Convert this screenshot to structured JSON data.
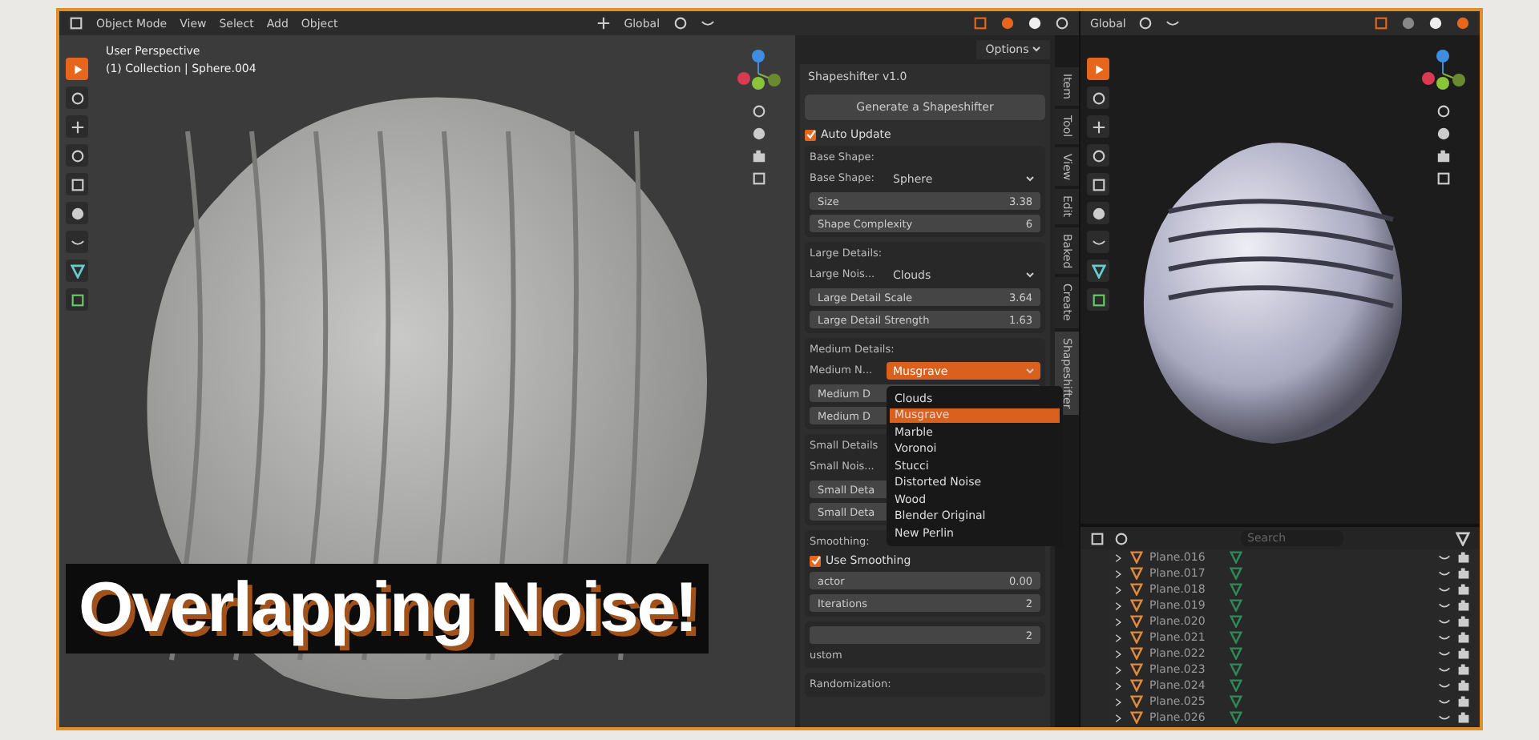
{
  "header_left": {
    "menu": [
      "Object Mode",
      "View",
      "Select",
      "Add",
      "Object"
    ],
    "orientation": "Global"
  },
  "viewport_left": {
    "info": [
      "User Perspective",
      "(1) Collection | Sphere.004"
    ]
  },
  "header_right": {
    "orientation": "Global"
  },
  "options_button": "Options",
  "panel": {
    "title": "Shapeshifter v1.0",
    "generate_button": "Generate a Shapeshifter",
    "auto_update": {
      "label": "Auto Update",
      "checked": true
    },
    "sections": [
      {
        "title": "Base Shape:",
        "rows": [
          {
            "kind": "select",
            "label": "Base Shape:",
            "value": "Sphere",
            "open": false
          },
          {
            "kind": "field",
            "label": "Size",
            "value": "3.38"
          },
          {
            "kind": "field",
            "label": "Shape Complexity",
            "value": "6"
          }
        ]
      },
      {
        "title": "Large Details:",
        "rows": [
          {
            "kind": "select",
            "label": "Large Nois...",
            "value": "Clouds",
            "open": false
          },
          {
            "kind": "field",
            "label": "Large Detail Scale",
            "value": "3.64"
          },
          {
            "kind": "field",
            "label": "Large Detail Strength",
            "value": "1.63"
          }
        ]
      },
      {
        "title": "Medium Details:",
        "rows": [
          {
            "kind": "select",
            "label": "Medium N...",
            "value": "Musgrave",
            "open": true
          },
          {
            "kind": "field",
            "label": "Medium D"
          },
          {
            "kind": "field",
            "label": "Medium D"
          }
        ]
      },
      {
        "title": "Small Details",
        "rows": [
          {
            "kind": "select",
            "label": "Small Nois..."
          },
          {
            "kind": "field",
            "label": "Small Deta"
          },
          {
            "kind": "field",
            "label": "Small Deta"
          }
        ]
      },
      {
        "title": "Smoothing:",
        "rows": [
          {
            "kind": "checkbox",
            "label": "Use Smoothing",
            "checked": true
          },
          {
            "kind": "field",
            "label": "actor",
            "value": "0.00"
          },
          {
            "kind": "field",
            "label": "Iterations",
            "value": "2"
          }
        ]
      },
      {
        "rows": [
          {
            "kind": "field",
            "value": "2"
          },
          {
            "kind": "text",
            "label": "ustom"
          }
        ]
      },
      {
        "title": "Randomization:"
      }
    ]
  },
  "dropdown": {
    "items": [
      {
        "label": "Clouds",
        "selected": false
      },
      {
        "label": "Musgrave",
        "selected": true
      },
      {
        "label": "Marble",
        "selected": false
      },
      {
        "label": "Voronoi",
        "selected": false
      },
      {
        "label": "Stucci",
        "selected": false
      },
      {
        "label": "Distorted Noise",
        "selected": false
      },
      {
        "label": "Wood",
        "selected": false
      },
      {
        "label": "Blender Original",
        "selected": false
      },
      {
        "label": "New Perlin",
        "selected": false
      }
    ]
  },
  "sidebar_tabs": [
    {
      "label": "Item",
      "selected": false
    },
    {
      "label": "Tool",
      "selected": false
    },
    {
      "label": "View",
      "selected": false
    },
    {
      "label": "Edit",
      "selected": false
    },
    {
      "label": "Baked",
      "selected": false
    },
    {
      "label": "Create",
      "selected": false
    },
    {
      "label": "Shapeshifter",
      "selected": true
    }
  ],
  "outliner": {
    "search": {
      "placeholder": "Search"
    },
    "rows": [
      "Plane.016",
      "Plane.017",
      "Plane.018",
      "Plane.019",
      "Plane.020",
      "Plane.021",
      "Plane.022",
      "Plane.023",
      "Plane.024",
      "Plane.025",
      "Plane.026"
    ]
  },
  "overlay_title": "Overlapping Noise!"
}
